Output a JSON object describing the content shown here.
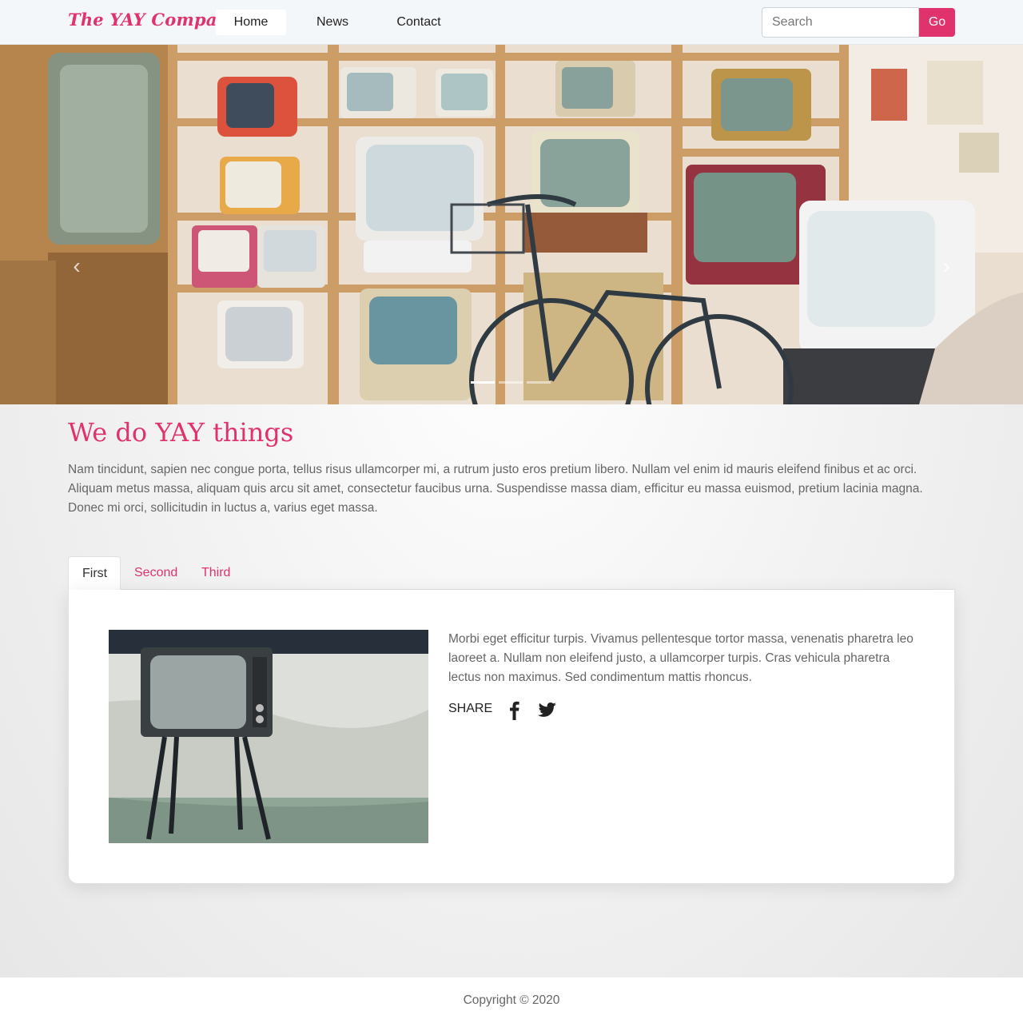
{
  "brand": "The YAY Company",
  "nav": {
    "items": [
      {
        "label": "Home",
        "active": true
      },
      {
        "label": "News",
        "active": false
      },
      {
        "label": "Contact",
        "active": false
      }
    ]
  },
  "search": {
    "placeholder": "Search",
    "value": "",
    "button_label": "Go"
  },
  "carousel": {
    "prev_icon": "chevron-left-icon",
    "next_icon": "chevron-right-icon",
    "prev_glyph": "‹",
    "next_glyph": "›",
    "slides": 3,
    "active_slide": 1
  },
  "intro": {
    "title": "We do YAY things",
    "text": "Nam tincidunt, sapien nec congue porta, tellus risus ullamcorper mi, a rutrum justo eros pretium libero. Nullam vel enim id mauris eleifend finibus et ac orci. Aliquam metus massa, aliquam quis arcu sit amet, consectetur faucibus urna. Suspendisse massa diam, efficitur eu massa euismod, pretium lacinia magna. Donec mi orci, sollicitudin in luctus a, varius eget massa."
  },
  "tabs": [
    {
      "label": "First",
      "active": true
    },
    {
      "label": "Second",
      "active": false
    },
    {
      "label": "Third",
      "active": false
    }
  ],
  "tab_content": {
    "text": "Morbi eget efficitur turpis. Vivamus pellentesque tortor massa, venenatis pharetra leo laoreet a. Nullam non eleifend justo, a ullamcorper turpis. Cras vehicula pharetra lectus non maximus. Sed condimentum mattis rhoncus.",
    "share_label": "SHARE",
    "social": [
      "facebook-icon",
      "twitter-icon"
    ]
  },
  "footer": {
    "copyright": "Copyright © 2020"
  },
  "colors": {
    "accent": "#e0336d",
    "navbar_bg": "#f4f7fa"
  }
}
